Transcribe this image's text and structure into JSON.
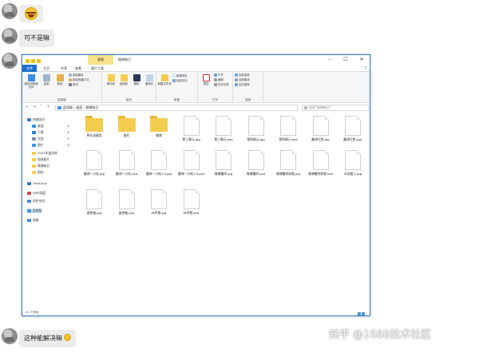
{
  "chat": {
    "messages": [
      {
        "type": "emoji",
        "icon": "grinning-emoji-icon"
      },
      {
        "type": "text",
        "text": "可不是嘛"
      },
      {
        "type": "screenshot"
      },
      {
        "type": "text",
        "text": "这种能解决嘛",
        "icon": "smile-emoji-icon"
      }
    ]
  },
  "window": {
    "title": "微博每日",
    "context_tab": "管理",
    "tabs": [
      "文件",
      "主页",
      "共享",
      "查看",
      "图片工具"
    ],
    "ribbon": {
      "clipboard": {
        "label": "剪贴板",
        "pin": "固定到快速访问",
        "copy": "复制",
        "paste": "粘贴",
        "copy_path": "复制路径",
        "paste_shortcut": "粘贴快捷方式",
        "cut": "剪切"
      },
      "organize": {
        "label": "组织",
        "move_to": "移动到",
        "copy_to": "复制到",
        "delete": "删除",
        "rename": "重命名"
      },
      "new": {
        "label": "新建",
        "new_folder": "新建文件夹",
        "new_item": "新建项目",
        "easy_access": "轻松访问"
      },
      "open": {
        "label": "打开",
        "properties": "属性",
        "open": "打开",
        "edit": "编辑",
        "history": "历史记录"
      },
      "select": {
        "label": "选择",
        "select_all": "全部选择",
        "select_none": "全部取消",
        "invert": "反向选择"
      }
    },
    "address": {
      "path": [
        "此电脑",
        "桌面",
        "微博每日"
      ],
      "search_placeholder": "搜索\"微博每日\""
    },
    "navpane": [
      {
        "label": "快速访问",
        "icon": "star-icon",
        "color": "#2b7cd3"
      },
      {
        "label": "桌面",
        "icon": "desktop-icon",
        "color": "#3a8ee6",
        "pinned": true
      },
      {
        "label": "下载",
        "icon": "download-icon",
        "color": "#2b7cd3",
        "pinned": true
      },
      {
        "label": "文档",
        "icon": "document-icon",
        "color": "#7a8ca0",
        "pinned": true
      },
      {
        "label": "图片",
        "icon": "picture-icon",
        "color": "#3a8ee6",
        "pinned": true
      },
      {
        "label": "2021年度总结",
        "icon": "folder-icon",
        "color": "#f4cc4d"
      },
      {
        "label": "地球照片",
        "icon": "folder-icon",
        "color": "#f4cc4d"
      },
      {
        "label": "微博每日",
        "icon": "folder-icon",
        "color": "#f4cc4d"
      },
      {
        "label": "地标",
        "icon": "folder-icon",
        "color": "#f4cc4d"
      },
      {
        "label": "OneDrive",
        "icon": "cloud-icon",
        "color": "#2b7cd3"
      },
      {
        "label": "WPS网盘",
        "icon": "cloud-icon",
        "color": "#d9463b"
      },
      {
        "label": "同步空间",
        "icon": "sync-icon",
        "color": "#3a8ee6"
      },
      {
        "label": "此电脑",
        "icon": "computer-icon",
        "color": "#3a8ee6"
      },
      {
        "label": "网络",
        "icon": "network-icon",
        "color": "#3a8ee6"
      }
    ],
    "files": [
      {
        "name": "草孔创意类",
        "kind": "folder"
      },
      {
        "name": "图片",
        "kind": "folder"
      },
      {
        "name": "微博",
        "kind": "folder"
      },
      {
        "name": "第三章元.jpg",
        "kind": "file"
      },
      {
        "name": "第三章元.psd",
        "kind": "file"
      },
      {
        "name": "第四章元.jpg",
        "kind": "file"
      },
      {
        "name": "第四章元.psd",
        "kind": "file"
      },
      {
        "name": "翻译打脸.jpg",
        "kind": "file"
      },
      {
        "name": "翻译打脸.psd",
        "kind": "file"
      },
      {
        "name": "翻译一小吃.jpg",
        "kind": "file"
      },
      {
        "name": "翻译一小吃.psd",
        "kind": "file"
      },
      {
        "name": "翻译一小吃1.5.jpg",
        "kind": "file"
      },
      {
        "name": "翻译一小吃1.5.psd",
        "kind": "file"
      },
      {
        "name": "微博最终.jpg",
        "kind": "file"
      },
      {
        "name": "微博最终.psd",
        "kind": "file"
      },
      {
        "name": "微博最终样图.jpg",
        "kind": "file"
      },
      {
        "name": "微博最终样图.psd",
        "kind": "file"
      },
      {
        "name": "半份题-1.jpg",
        "kind": "file"
      },
      {
        "name": "星梦者.jpg",
        "kind": "file"
      },
      {
        "name": "星梦者.psd",
        "kind": "file"
      },
      {
        "name": "咔评赞.jpg",
        "kind": "file"
      },
      {
        "name": "咔评赞.psd",
        "kind": "file"
      }
    ],
    "status": "22 个项目"
  },
  "watermark": "知乎 @1688技术社区"
}
